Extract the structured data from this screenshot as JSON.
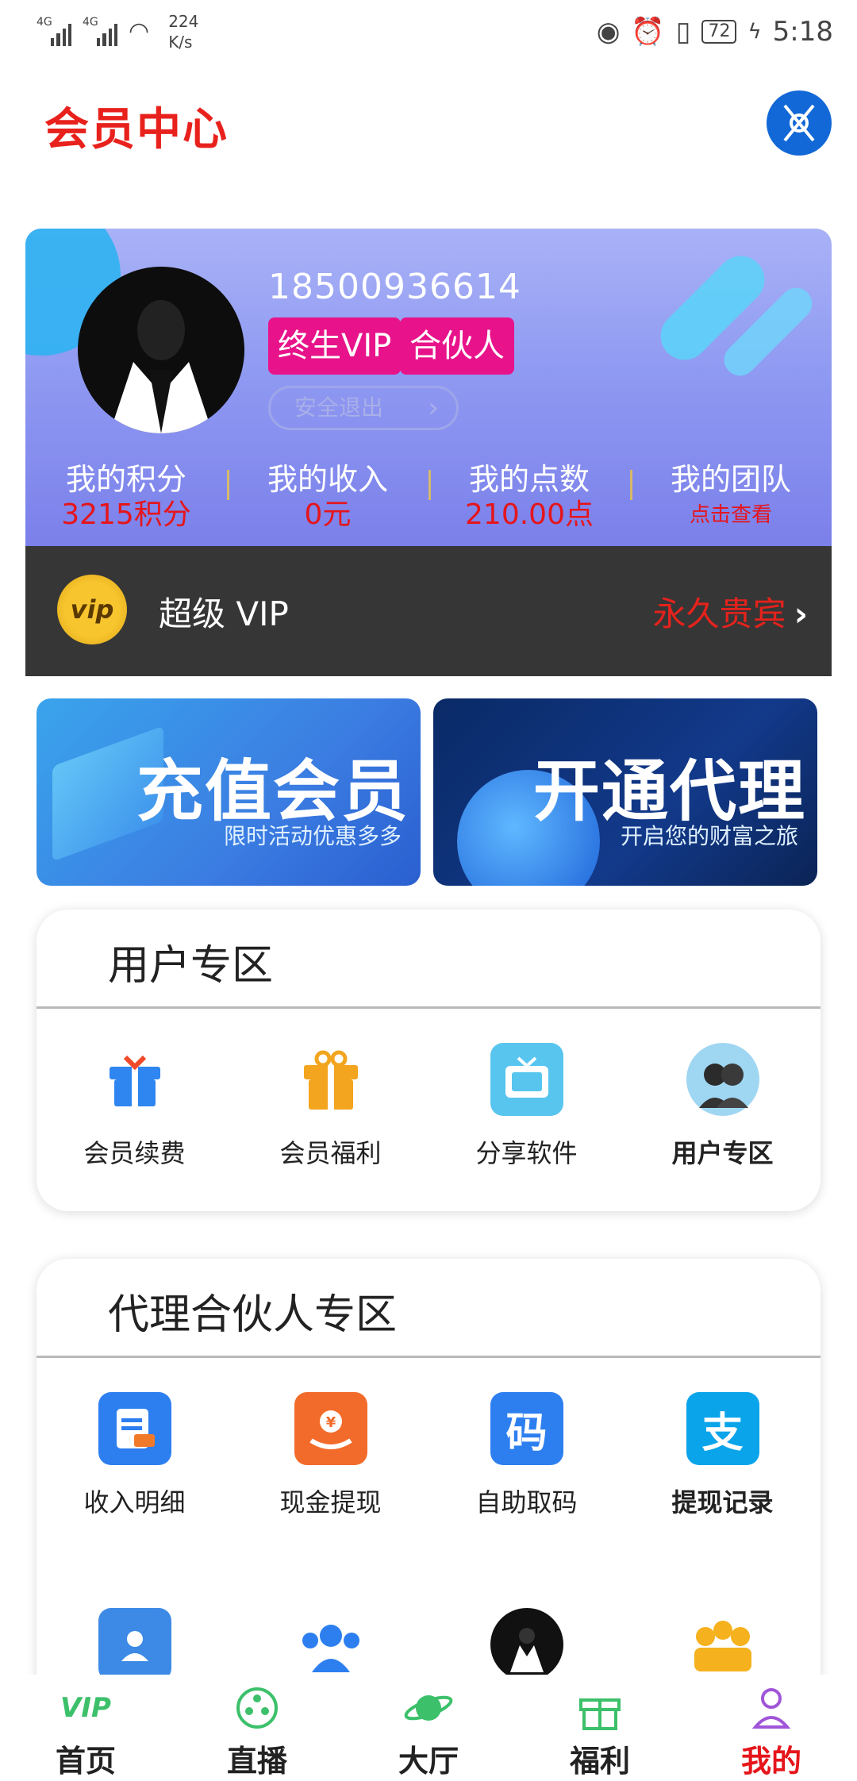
{
  "status_bar": {
    "sim1": "4G",
    "sim2": "4G",
    "speed_value": "224",
    "speed_unit": "K/s",
    "battery": "72",
    "time": "5:18"
  },
  "header": {
    "title": "会员中心"
  },
  "profile": {
    "phone": "18500936614",
    "tags": [
      "终生VIP",
      "合伙人"
    ],
    "logout_label": "安全退出",
    "stats": [
      {
        "label": "我的积分",
        "value": "3215积分"
      },
      {
        "label": "我的收入",
        "value": "0元"
      },
      {
        "label": "我的点数",
        "value": "210.00点"
      },
      {
        "label": "我的团队",
        "value": "点击查看"
      }
    ]
  },
  "vip_bar": {
    "badge": "vip",
    "label": "超级 VIP",
    "status": "永久贵宾",
    "chevron": "›"
  },
  "banners": {
    "recharge": {
      "title": "充值会员",
      "subtitle": "限时活动优惠多多"
    },
    "agent": {
      "title": "开通代理",
      "subtitle": "开启您的财富之旅"
    }
  },
  "user_zone": {
    "title": "用户专区",
    "items": [
      {
        "label": "会员续费",
        "icon": "gift-icon"
      },
      {
        "label": "会员福利",
        "icon": "gift-box-icon"
      },
      {
        "label": "分享软件",
        "icon": "tv-icon"
      },
      {
        "label": "用户专区",
        "icon": "users-avatar-icon"
      }
    ]
  },
  "agent_zone": {
    "title": "代理合伙人专区",
    "items": [
      {
        "label": "收入明细",
        "icon": "document-icon"
      },
      {
        "label": "现金提现",
        "icon": "yen-hand-icon"
      },
      {
        "label": "自助取码",
        "icon": "code-icon",
        "glyph": "码"
      },
      {
        "label": "提现记录",
        "icon": "alipay-icon",
        "glyph": "支"
      }
    ],
    "row2_icons": [
      "contact-card-icon",
      "group-icon",
      "vip-avatar-icon",
      "vip-crowd-icon"
    ]
  },
  "tabbar": {
    "items": [
      {
        "label": "首页",
        "icon": "vip-logo-icon",
        "glyph": "VIP"
      },
      {
        "label": "直播",
        "icon": "film-reel-icon"
      },
      {
        "label": "大厅",
        "icon": "planet-icon"
      },
      {
        "label": "福利",
        "icon": "gift-outline-icon"
      },
      {
        "label": "我的",
        "icon": "person-icon"
      }
    ]
  },
  "colors": {
    "accent_red": "#e5151b",
    "tag_pink": "#e8138a",
    "card_purple": "#8f9af2",
    "vip_bar": "#363636"
  }
}
